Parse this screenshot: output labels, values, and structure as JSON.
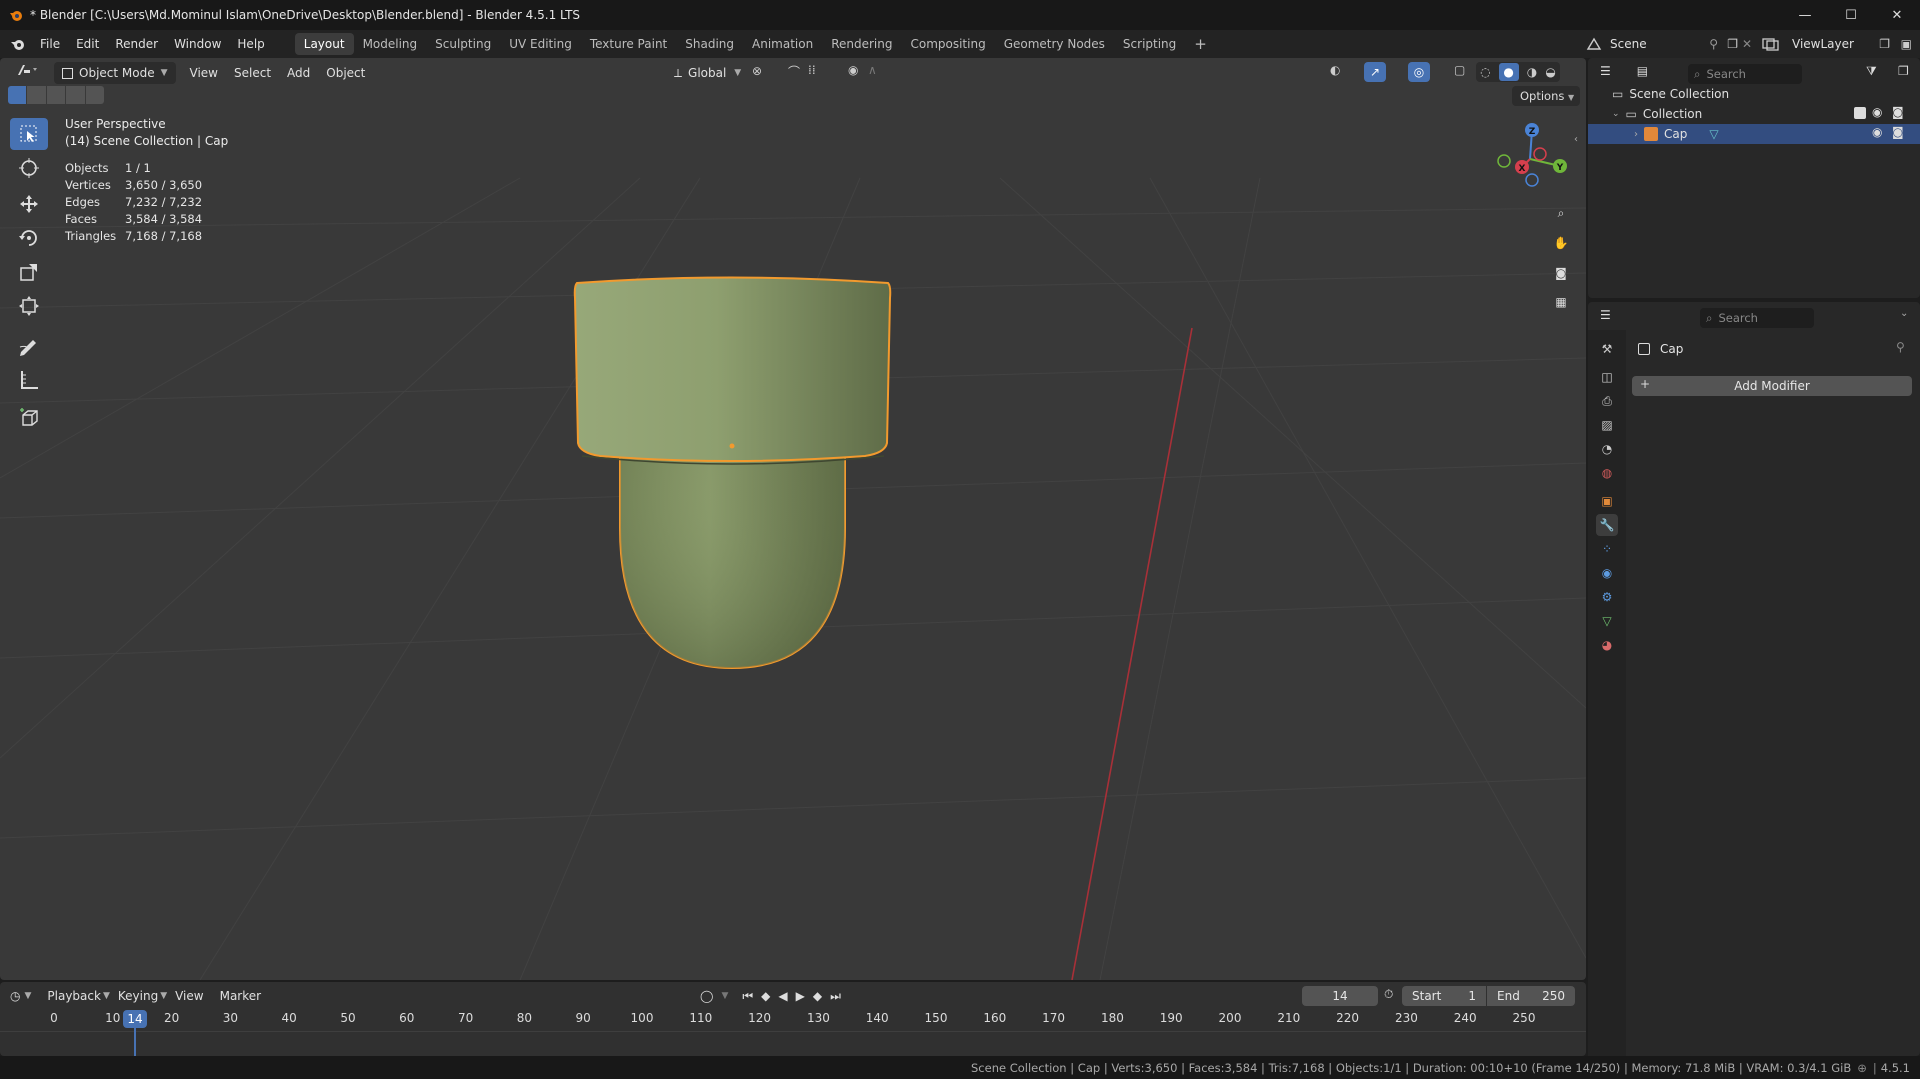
{
  "window": {
    "title": "* Blender [C:\\Users\\Md.Mominul Islam\\OneDrive\\Desktop\\Blender.blend] - Blender 4.5.1 LTS",
    "minimize": "—",
    "maximize": "☐",
    "close": "✕"
  },
  "menu": [
    "File",
    "Edit",
    "Render",
    "Window",
    "Help"
  ],
  "workspaces": [
    "Layout",
    "Modeling",
    "Sculpting",
    "UV Editing",
    "Texture Paint",
    "Shading",
    "Animation",
    "Rendering",
    "Compositing",
    "Geometry Nodes",
    "Scripting"
  ],
  "workspace_add": "+",
  "active_workspace": "Layout",
  "scene": {
    "name": "Scene",
    "view_layer": "ViewLayer"
  },
  "viewport": {
    "mode": "Object Mode",
    "menus": [
      "View",
      "Select",
      "Add",
      "Object"
    ],
    "transform_orientation": "Global",
    "options_label": "Options",
    "perspective": "User Perspective",
    "context": "(14) Scene Collection | Cap",
    "stats": [
      {
        "label": "Objects",
        "value": "1 / 1"
      },
      {
        "label": "Vertices",
        "value": "3,650 / 3,650"
      },
      {
        "label": "Edges",
        "value": "7,232 / 7,232"
      },
      {
        "label": "Faces",
        "value": "3,584 / 3,584"
      },
      {
        "label": "Triangles",
        "value": "7,168 / 7,168"
      }
    ],
    "gizmo": {
      "x": "X",
      "y": "Y",
      "z": "Z"
    },
    "colors": {
      "background": "#393939",
      "mesh": "#8a9a6a",
      "outline": "#f29a2e",
      "x_axis": "#b2323a"
    }
  },
  "outliner": {
    "search_placeholder": "Search",
    "scene_collection": "Scene Collection",
    "collection": "Collection",
    "object": "Cap"
  },
  "properties": {
    "search_placeholder": "Search",
    "object_name": "Cap",
    "add_modifier": "Add Modifier",
    "add_icon": "+"
  },
  "timeline": {
    "menus": [
      "Playback",
      "Keying",
      "View",
      "Marker"
    ],
    "current_frame": "14",
    "start_label": "Start",
    "start": "1",
    "end_label": "End",
    "end": "250",
    "ticks": [
      "0",
      "10",
      "20",
      "30",
      "40",
      "50",
      "60",
      "70",
      "80",
      "90",
      "100",
      "110",
      "120",
      "130",
      "140",
      "150",
      "160",
      "170",
      "180",
      "190",
      "200",
      "210",
      "220",
      "230",
      "240",
      "250"
    ]
  },
  "statusbar": {
    "text": "Scene Collection | Cap | Verts:3,650 | Faces:3,584 | Tris:7,168 | Objects:1/1 | Duration: 00:10+10 (Frame 14/250) | Memory: 71.8 MiB | VRAM: 0.3/4.1 GiB",
    "version": "4.5.1"
  }
}
